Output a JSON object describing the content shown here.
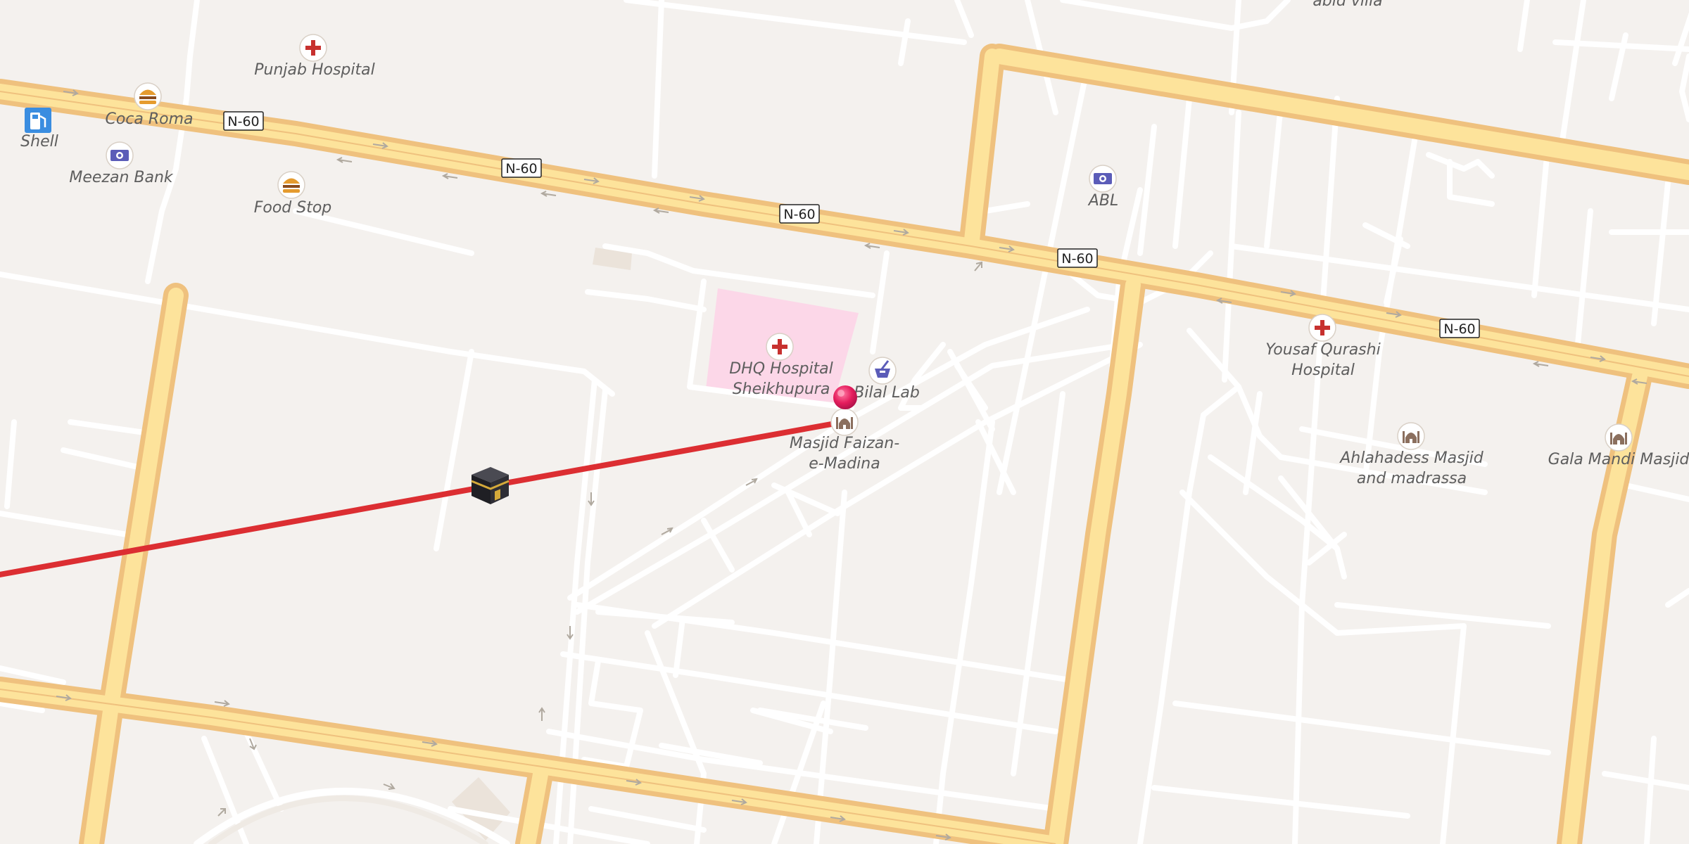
{
  "map": {
    "road_shield_label": "N-60",
    "colors": {
      "background": "#f4f1ee",
      "minor_road": "#ffffff",
      "major_road": "#fde39b",
      "major_road_casing": "#efc17e",
      "hospital_area": "#fcd7e8",
      "route_line": "#dc2e32",
      "pin": "#e51d5d"
    },
    "pois": {
      "punjab_hospital": "Punjab Hospital",
      "coca_roma": "Coca Roma",
      "shell": "Shell",
      "meezan_bank": "Meezan Bank",
      "food_stop": "Food Stop",
      "abl": "ABL",
      "dhq_hospital": [
        "DHQ Hospital",
        "Sheikhupura"
      ],
      "bilal_lab": "Bilal Lab",
      "masjid_faizan": [
        "Masjid Faizan-",
        "e-Madina"
      ],
      "yousaf_qurashi": [
        "Yousaf Qurashi",
        "Hospital"
      ],
      "ahlahadess": [
        "Ahlahadess Masjid",
        "and madrassa"
      ],
      "gala_mandi": "Gala Mandi Masjid",
      "abid_villa": "abid villa"
    },
    "icons": {
      "hospital": "hospital-cross-icon",
      "restaurant": "burger-icon",
      "fuel": "fuel-pump-icon",
      "bank": "banknote-icon",
      "pharmacy": "mortar-pestle-icon",
      "mosque": "mosque-icon",
      "qibla": "kaaba-icon",
      "location": "location-pin-icon"
    }
  }
}
